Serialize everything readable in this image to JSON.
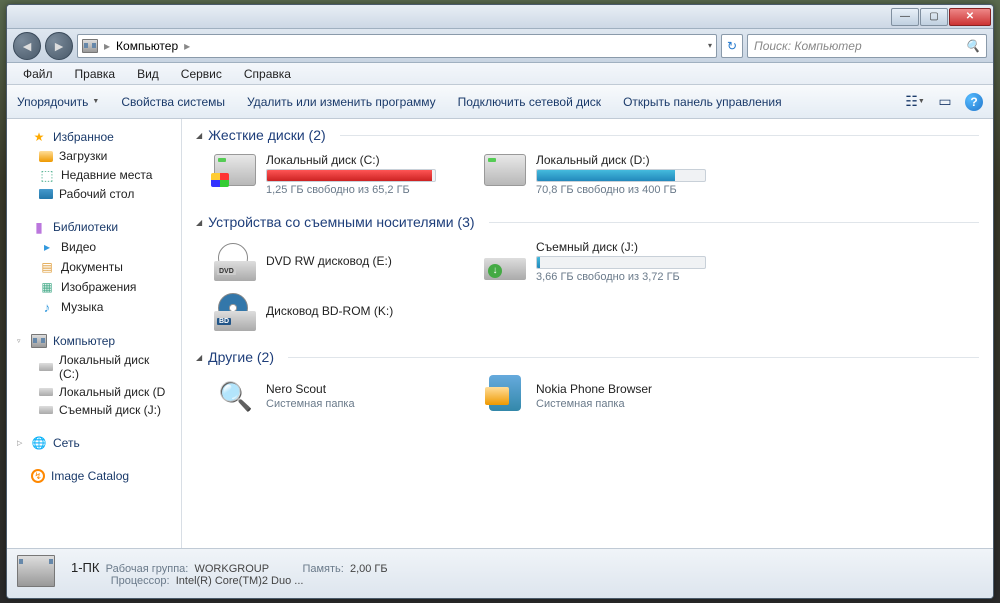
{
  "titlebar": {
    "min": "—",
    "max": "▢",
    "close": "✕"
  },
  "nav": {
    "back": "◄",
    "forward": "►",
    "breadcrumb_sep": "▸",
    "location": "Компьютер",
    "dropdown": "▾",
    "refresh": "↻",
    "search_placeholder": "Поиск: Компьютер",
    "search_icon": "🔍"
  },
  "menu": [
    "Файл",
    "Правка",
    "Вид",
    "Сервис",
    "Справка"
  ],
  "toolbar": {
    "items": [
      "Упорядочить",
      "Свойства системы",
      "Удалить или изменить программу",
      "Подключить сетевой диск",
      "Открыть панель управления"
    ],
    "dropdown": "▼",
    "help": "?"
  },
  "sidebar": {
    "collapse": "▷",
    "expand": "▿",
    "favorites": {
      "label": "Избранное",
      "items": [
        "Загрузки",
        "Недавние места",
        "Рабочий стол"
      ]
    },
    "libraries": {
      "label": "Библиотеки",
      "items": [
        "Видео",
        "Документы",
        "Изображения",
        "Музыка"
      ]
    },
    "computer": {
      "label": "Компьютер",
      "items": [
        "Локальный диск (С:)",
        "Локальный диск (D",
        "Съемный диск (J:)"
      ]
    },
    "network": {
      "label": "Сеть"
    },
    "image_catalog": {
      "label": "Image Catalog"
    }
  },
  "sections": {
    "hdd": {
      "title": "Жесткие диски (2)",
      "items": [
        {
          "name": "Локальный диск (С:)",
          "free": "1,25 ГБ свободно из 65,2 ГБ",
          "fill": 98,
          "color": "red"
        },
        {
          "name": "Локальный диск (D:)",
          "free": "70,8 ГБ свободно из 400 ГБ",
          "fill": 82,
          "color": "blue"
        }
      ]
    },
    "removable": {
      "title": "Устройства со съемными носителями (3)",
      "items": [
        {
          "name": "DVD RW дисковод (E:)",
          "type": "dvd",
          "label": "DVD"
        },
        {
          "name": "Съемный диск (J:)",
          "free": "3,66 ГБ свободно из 3,72 ГБ",
          "fill": 2,
          "color": "blue",
          "type": "removable"
        },
        {
          "name": "Дисковод BD-ROM (K:)",
          "type": "bd",
          "label": "BD"
        }
      ]
    },
    "other": {
      "title": "Другие (2)",
      "items": [
        {
          "name": "Nero Scout",
          "sub": "Системная папка",
          "type": "nero"
        },
        {
          "name": "Nokia Phone Browser",
          "sub": "Системная папка",
          "type": "nokia"
        }
      ]
    }
  },
  "status": {
    "name": "1-ПК",
    "workgroup_label": "Рабочая группа:",
    "workgroup": "WORKGROUP",
    "memory_label": "Память:",
    "memory": "2,00 ГБ",
    "cpu_label": "Процессор:",
    "cpu": "Intel(R) Core(TM)2 Duo ..."
  }
}
